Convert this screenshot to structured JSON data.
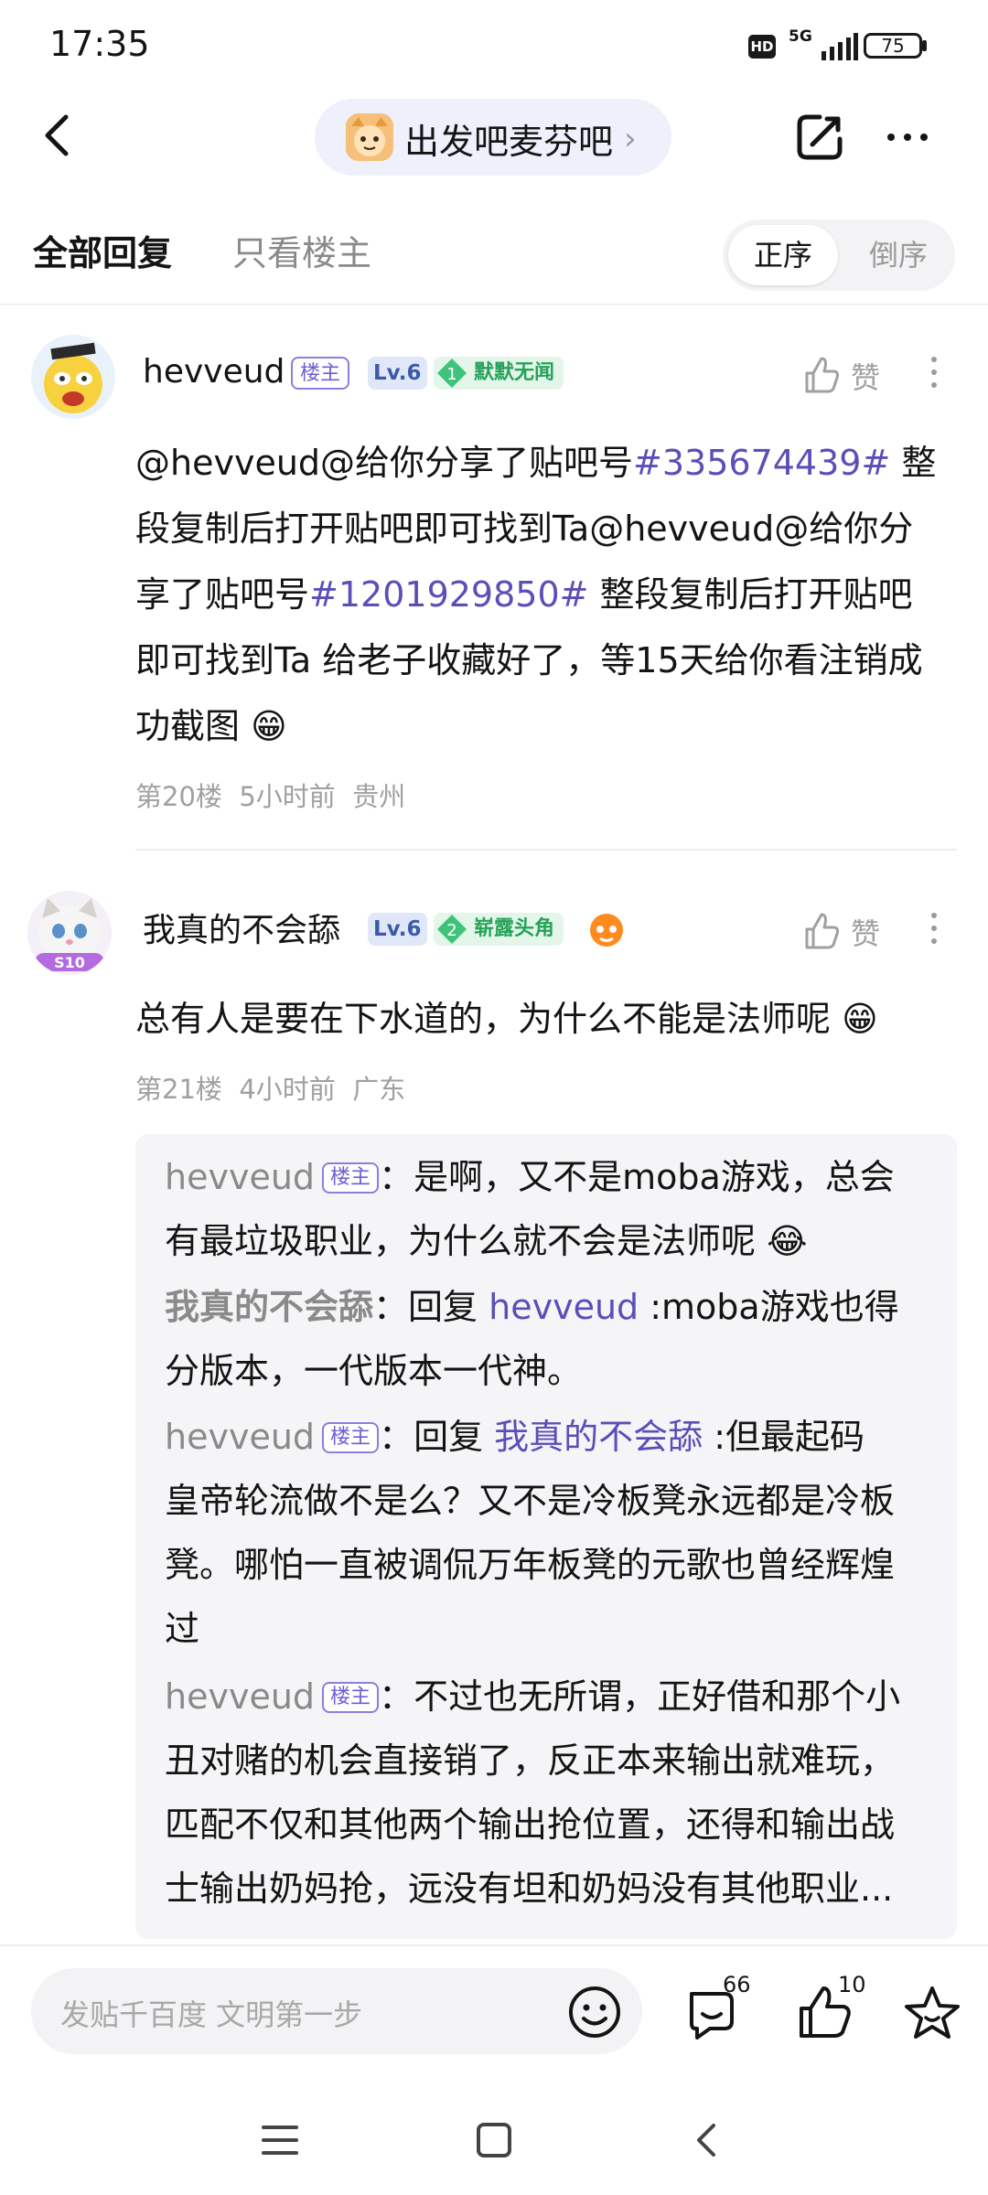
{
  "status_bar": {
    "time": "17:35",
    "hd": "HD",
    "network": "5G",
    "battery": "75"
  },
  "nav": {
    "forum_name": "出发吧麦芬吧",
    "chevron": "›"
  },
  "tabs": {
    "all": "全部回复",
    "op_only": "只看楼主",
    "order_asc": "正序",
    "order_desc": "倒序"
  },
  "posts": [
    {
      "username": "hevveud",
      "op_badge": "楼主",
      "level": "Lv.6",
      "title_rank": "1",
      "title": "默默无闻",
      "like_label": "赞",
      "body_lines": [
        [
          "@hevveud@给你分享了贴吧号",
          "#335674439#",
          "  整"
        ],
        [
          "段复制后打开贴吧即可找到Ta@hevveud@给你分"
        ],
        [
          "享了贴吧号",
          "#1201929850#",
          "  整段复制后打开贴吧"
        ],
        [
          "即可找到Ta 给老子收藏好了，等15天给你看注销成"
        ],
        [
          "功截图 😁"
        ]
      ],
      "floor": "第20楼",
      "time": "5小时前",
      "location": "贵州"
    },
    {
      "username": "我真的不会舔",
      "level": "Lv.6",
      "title_rank": "2",
      "title": "崭露头角",
      "avatar_badge": "S10",
      "like_label": "赞",
      "body": "总有人是要在下水道的，为什么不能是法师呢 😁",
      "floor": "第21楼",
      "time": "4小时前",
      "location": "广东"
    }
  ],
  "replies": [
    {
      "name": "hevveud",
      "badge": "楼主",
      "sep": "：",
      "text_lines": [
        "是啊，又不是moba游戏，总会",
        "有最垃圾职业，为什么就不会是法师呢 😂"
      ]
    },
    {
      "name": "我真的不会舔",
      "sep": "：",
      "prefix": "回复 ",
      "mention": "hevveud",
      "text_lines": [
        " :moba游戏也得",
        "分版本，一代版本一代神。"
      ]
    },
    {
      "name": "hevveud",
      "badge": "楼主",
      "sep": "：",
      "prefix": "回复 ",
      "mention": "我真的不会舔",
      "text_lines": [
        " :但最起码",
        "皇帝轮流做不是么？又不是冷板凳永远都是冷板",
        "凳。哪怕一直被调侃万年板凳的元歌也曾经辉煌",
        "过"
      ]
    },
    {
      "name": "hevveud",
      "badge": "楼主",
      "sep": "：",
      "text_lines": [
        "不过也无所谓，正好借和那个小",
        "丑对赌的机会直接销了，反正本来输出就难玩，",
        "匹配不仅和其他两个输出抢位置，还得和输出战",
        "士输出奶妈抢，远没有坦和奶妈没有其他职业..."
      ]
    }
  ],
  "bottom_bar": {
    "placeholder": "发贴千百度 文明第一步",
    "reply_count": "66",
    "like_count": "10"
  },
  "icons": [
    "back-icon",
    "share-icon",
    "more-icon",
    "like-icon",
    "kebab-icon",
    "emoji-icon",
    "comment-icon",
    "thumb-up-icon",
    "star-icon",
    "menu-icon",
    "home-icon",
    "nav-back-icon"
  ],
  "colors": {
    "accent": "#5a4fb8",
    "title_green": "#26a25a",
    "meta_gray": "#a0a0a0",
    "pill_bg": "#eef1fb"
  }
}
